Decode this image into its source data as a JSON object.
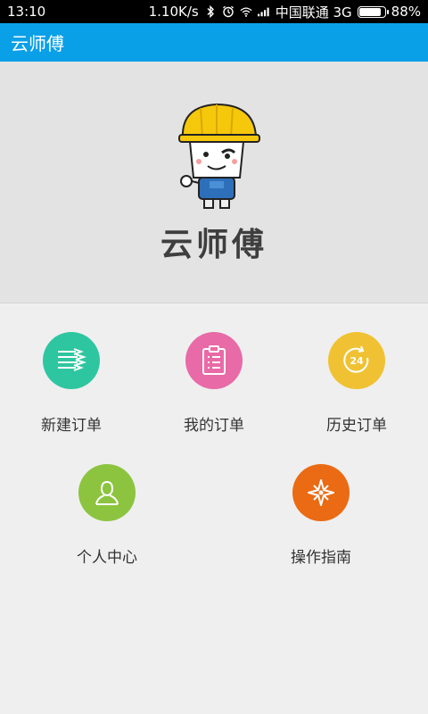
{
  "status_bar": {
    "time": "13:10",
    "network_speed": "1.10K/s",
    "carrier": "中国联通 3G",
    "battery_percent": "88%",
    "battery_level": 0.88,
    "icons": [
      "bluetooth-icon",
      "alarm-icon",
      "wifi-icon",
      "signal-icon",
      "battery-icon"
    ]
  },
  "app_bar": {
    "title": "云师傅"
  },
  "hero": {
    "brand_title": "云师傅"
  },
  "menu": [
    {
      "label": "新建订单",
      "icon": "new-order-icon",
      "color": "#2ec6a0"
    },
    {
      "label": "我的订单",
      "icon": "clipboard-icon",
      "color": "#e86aa7"
    },
    {
      "label": "历史订单",
      "icon": "history-24-icon",
      "color": "#f0c233"
    },
    {
      "label": "个人中心",
      "icon": "person-icon",
      "color": "#8cc43f"
    },
    {
      "label": "操作指南",
      "icon": "compass-icon",
      "color": "#ea6b13"
    }
  ],
  "colors": {
    "app_bar": "#0aa0e8",
    "hero_bg": "#e3e3e3",
    "page_bg": "#efefef",
    "helmet": "#f6c80c"
  }
}
